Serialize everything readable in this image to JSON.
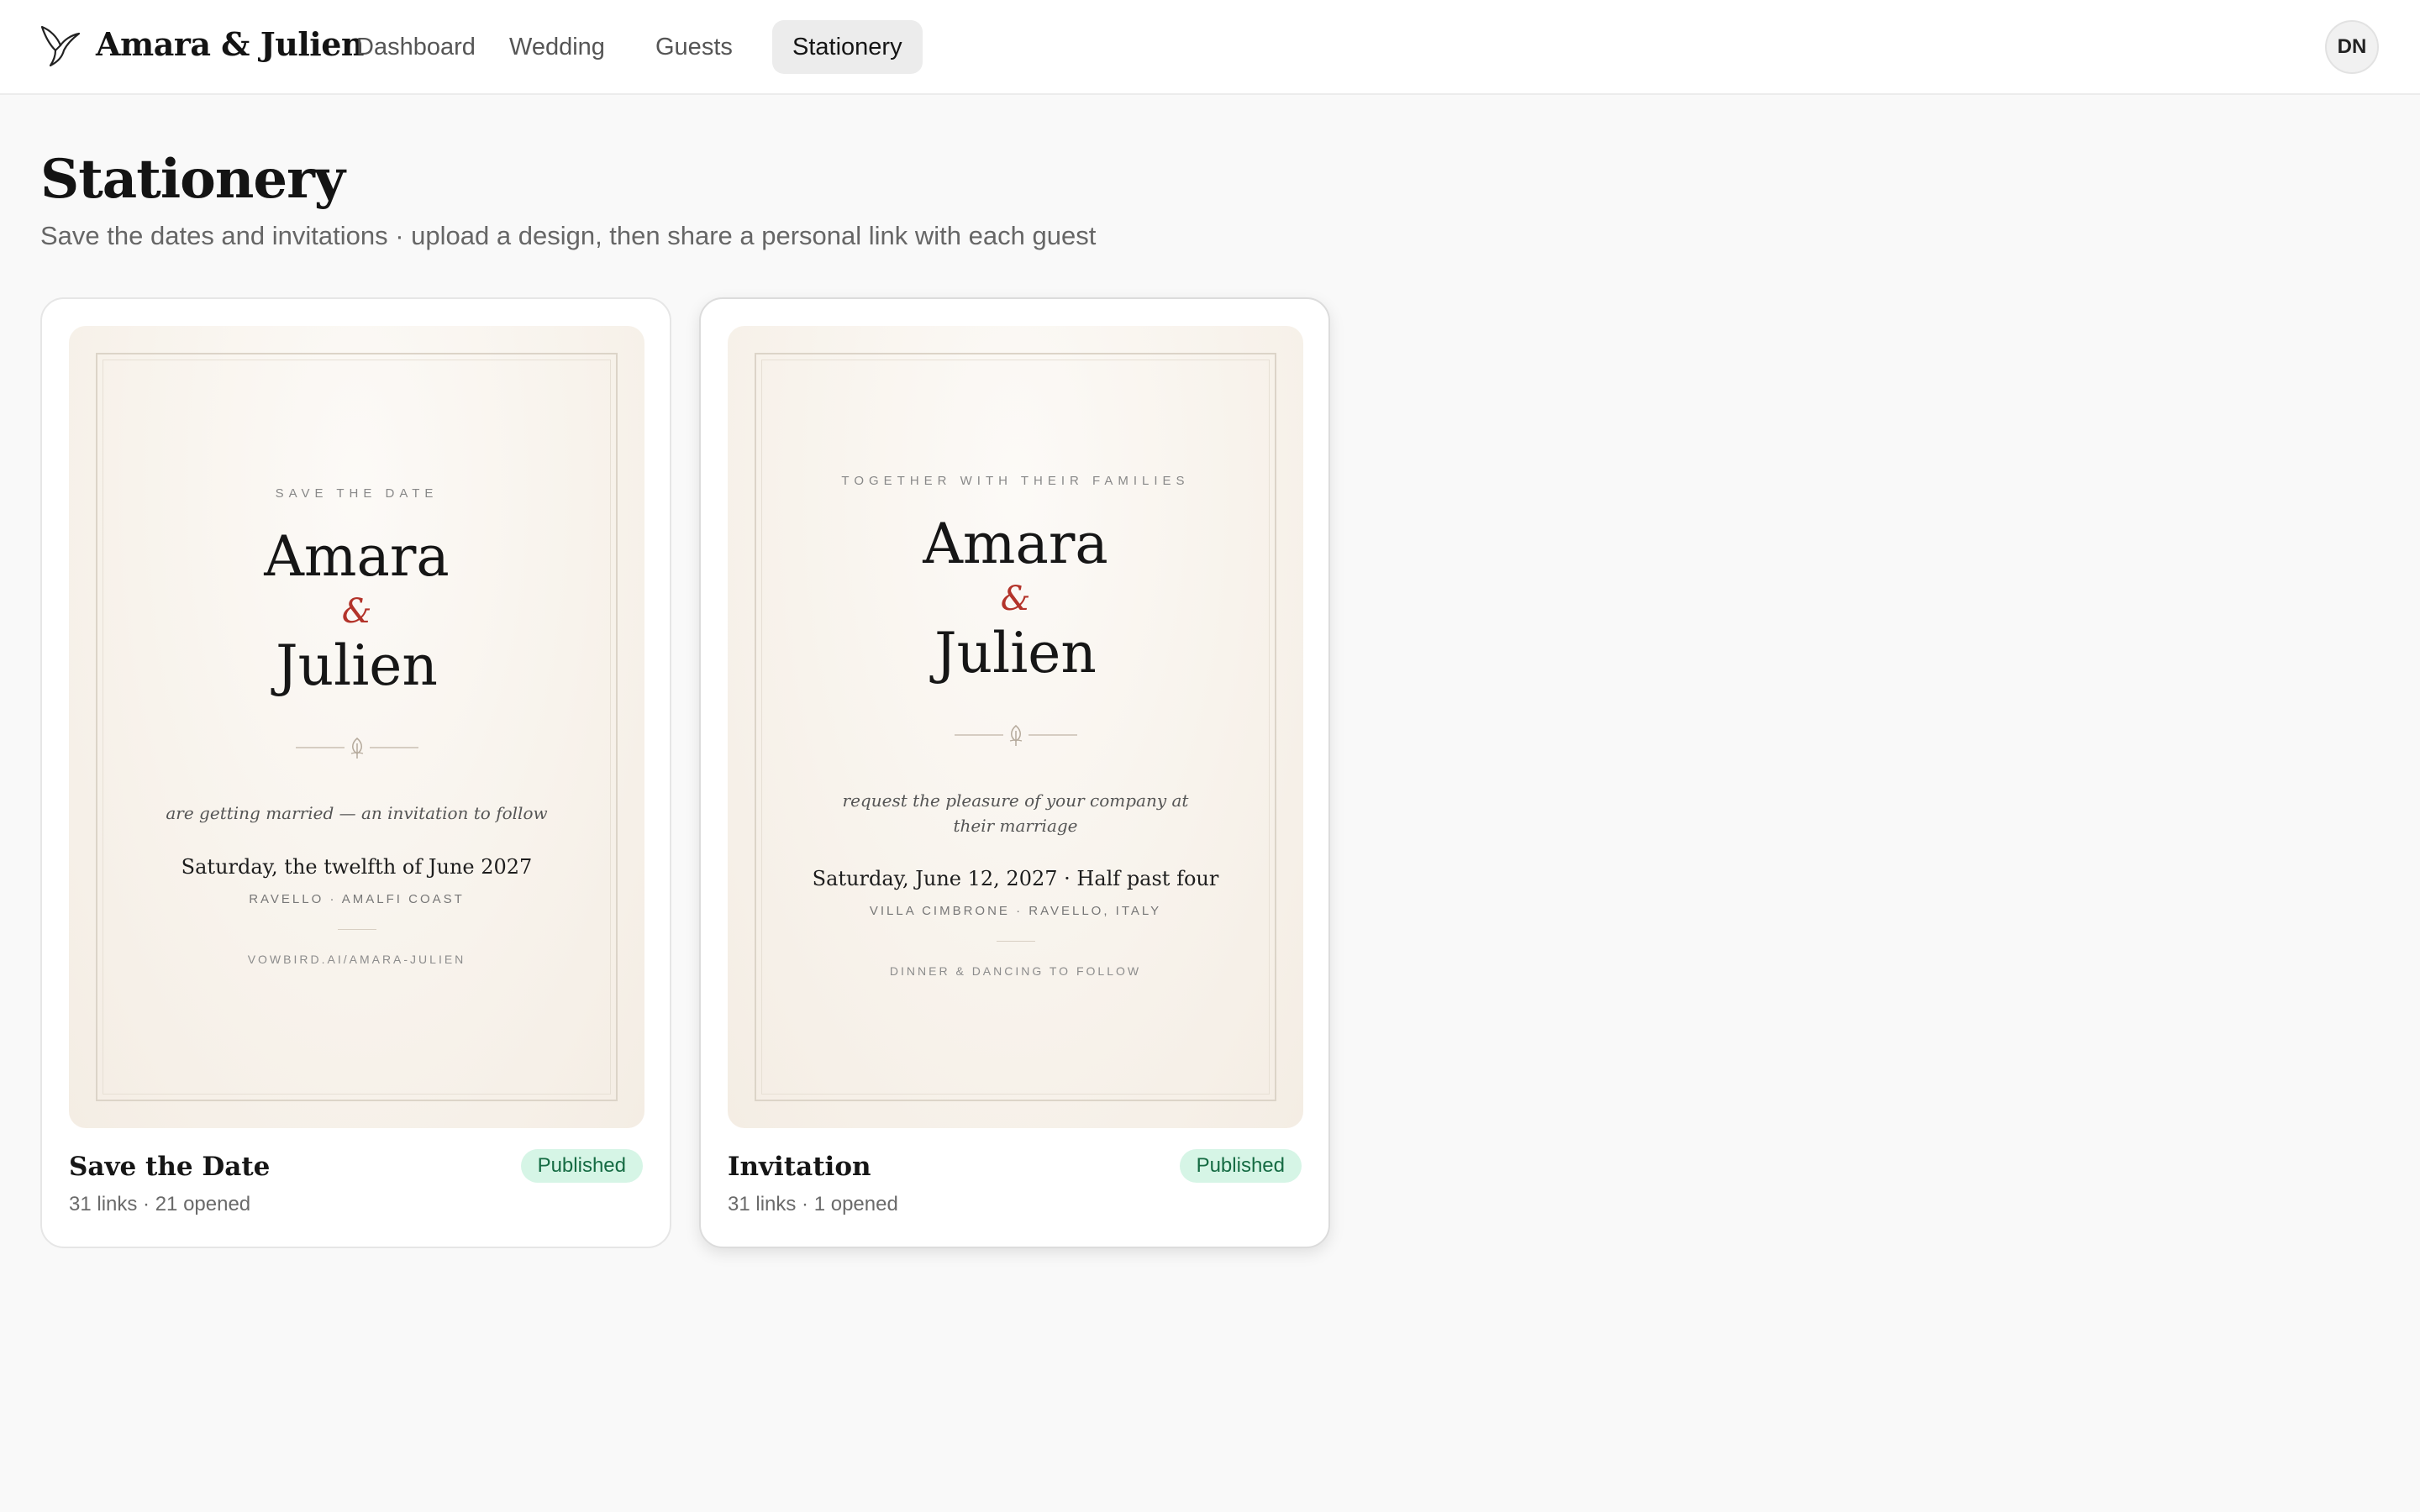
{
  "app": {
    "brand": "Amara & Julien",
    "logo_icon": "hummingbird-icon"
  },
  "nav": {
    "items": [
      {
        "label": "Dashboard",
        "active": false
      },
      {
        "label": "Wedding",
        "active": false
      },
      {
        "label": "Guests",
        "active": false
      },
      {
        "label": "Stationery",
        "active": true
      }
    ]
  },
  "user": {
    "initials": "DN"
  },
  "page": {
    "title": "Stationery",
    "subtitle": "Save the dates and invitations · upload a design, then share a personal link with each guest"
  },
  "cards": [
    {
      "title": "Save the Date",
      "meta": "31 links · 21 opened",
      "status": "Published",
      "preview": {
        "eyebrow": "SAVE THE DATE",
        "name1": "Amara",
        "amp": "&",
        "name2": "Julien",
        "line": "are getting married — an invitation to follow",
        "date": "Saturday, the twelfth of June 2027",
        "place": "RAVELLO · AMALFI COAST",
        "foot": "VOWBIRD.AI/AMARA-JULIEN"
      }
    },
    {
      "title": "Invitation",
      "meta": "31 links · 1 opened",
      "status": "Published",
      "preview": {
        "eyebrow": "TOGETHER WITH THEIR FAMILIES",
        "name1": "Amara",
        "amp": "&",
        "name2": "Julien",
        "line": "request the pleasure of your company at their marriage",
        "date": "Saturday, June 12, 2027 · Half past four",
        "place": "VILLA CIMBRONE · RAVELLO, ITALY",
        "foot": "DINNER & DANCING TO FOLLOW"
      }
    }
  ],
  "colors": {
    "accent_amp": "#b3332a",
    "badge_bg": "#d6f5e6",
    "badge_text": "#156b43",
    "page_bg": "#f9f9f9"
  }
}
